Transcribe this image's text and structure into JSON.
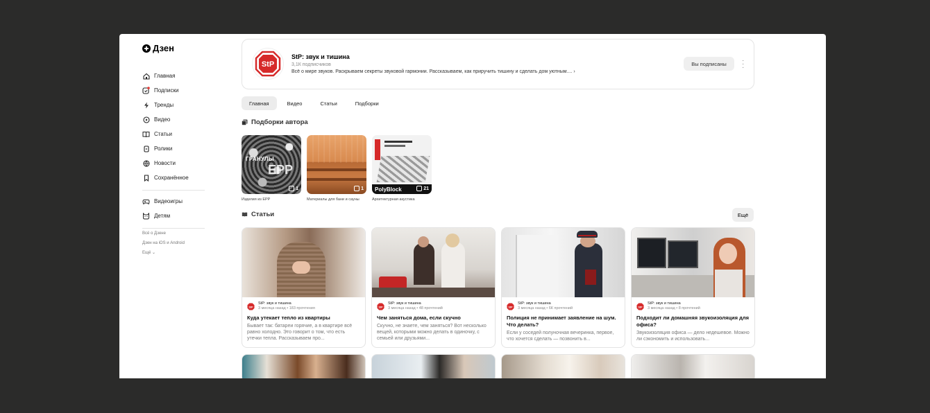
{
  "app": {
    "logo_text": "Дзен"
  },
  "sidebar": {
    "items": [
      {
        "label": "Главная",
        "icon": "home-icon"
      },
      {
        "label": "Подписки",
        "icon": "subscriptions-icon"
      },
      {
        "label": "Тренды",
        "icon": "trends-icon"
      },
      {
        "label": "Видео",
        "icon": "video-icon"
      },
      {
        "label": "Статьи",
        "icon": "articles-icon"
      },
      {
        "label": "Ролики",
        "icon": "clips-icon"
      },
      {
        "label": "Новости",
        "icon": "news-icon"
      },
      {
        "label": "Сохранённое",
        "icon": "bookmark-icon"
      }
    ],
    "extra_items": [
      {
        "label": "Видеоигры",
        "icon": "gamepad-icon"
      },
      {
        "label": "Детям",
        "icon": "kids-icon"
      }
    ],
    "footer": {
      "about": "Всё о Дзене",
      "apps": "Дзен на iOS и Android",
      "more": "Ещё"
    }
  },
  "channel": {
    "logo_text": "StP",
    "name": "StP: звук и тишина",
    "subscribers": "3,1К подписчиков",
    "description": "Всё о мире звуков. Раскрываем секреты звуковой гармонии. Рассказываем, как приручить тишину и сделать дом уютным....",
    "subscribe_label": "Вы подписаны",
    "brand_color": "#d62a2a"
  },
  "tabs": [
    {
      "label": "Главная",
      "active": true
    },
    {
      "label": "Видео",
      "active": false
    },
    {
      "label": "Статьи",
      "active": false
    },
    {
      "label": "Подборки",
      "active": false
    }
  ],
  "collections": {
    "title": "Подборки автора",
    "items": [
      {
        "caption": "Изделия из EPP",
        "count": "1",
        "overlay_line1": "ГРАНУЛЫ",
        "overlay_line2": "EPP"
      },
      {
        "caption": "Материалы для бани и сауны",
        "count": "1"
      },
      {
        "caption": "Архитектурная акустика",
        "count": "21",
        "overlay_label": "PolyBlock"
      }
    ]
  },
  "articles": {
    "title": "Статьи",
    "more_label": "Ещё",
    "items": [
      {
        "author": "StP: звук и тишина",
        "meta": "3 месяца назад • 183 прочтения",
        "title": "Куда утекает тепло из квартиры",
        "snippet": "Бывает так: батареи горячие, а в квартире всё равно холодно. Это говорит о том, что есть утечки тепла. Рассказываем про..."
      },
      {
        "author": "StP: звук и тишина",
        "meta": "3 месяца назад • 48 прочтений",
        "title": "Чем заняться дома, если скучно",
        "snippet": "Скучно, не знаете, чем заняться? Вот несколько вещей, которыми можно делать в одиночку, с семьей или друзьями..."
      },
      {
        "author": "StP: звук и тишина",
        "meta": "3 месяца назад • 6К прочтений",
        "title": "Полиция не принимает заявление на шум. Что делать?",
        "snippet": "Если у соседей полуночная вечеринка, первое, что хочется сделать — позвонить в..."
      },
      {
        "author": "StP: звук и тишина",
        "meta": "3 месяца назад • 8 прочтений",
        "title": "Подходит ли домашняя звукоизоляция для офиса?",
        "snippet": "Звукоизоляция офиса — дело недешевое. Можно ли сэкономить и использовать..."
      }
    ]
  }
}
